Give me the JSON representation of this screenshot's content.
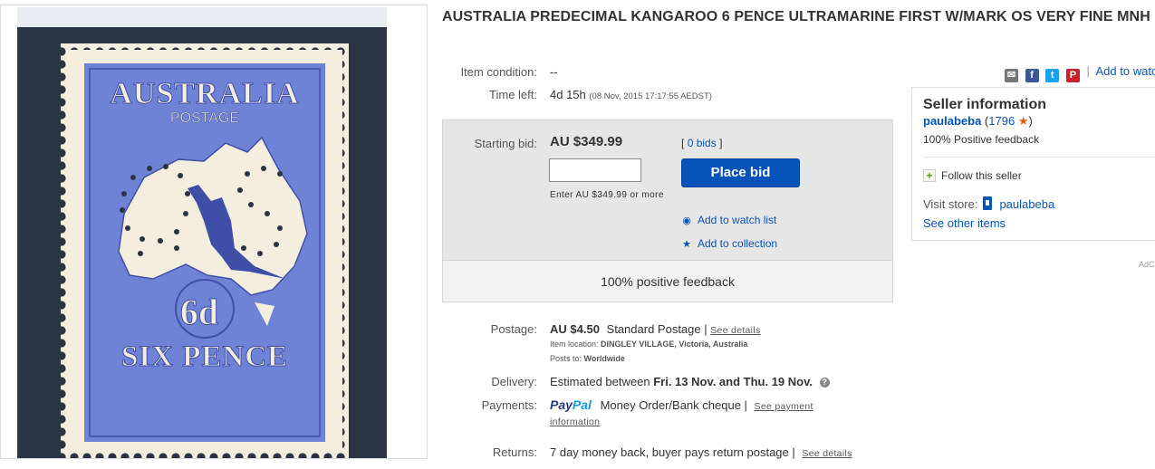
{
  "title": "AUSTRALIA PREDECIMAL KANGAROO 6 PENCE ULTRAMARINE FIRST W/MARK OS VERY FINE MNH",
  "stamp": {
    "top_text": "AUSTRALIA",
    "sub_text": "POSTAGE",
    "value_text": "6d",
    "bottom_text": "SIX PENCE"
  },
  "condition": {
    "label": "Item condition:",
    "value": "--"
  },
  "time_left": {
    "label": "Time left:",
    "value": "4d 15h",
    "detail": "(08 Nov, 2015   17:17:55 AEDST)"
  },
  "bid": {
    "label": "Starting bid:",
    "price": "AU $349.99",
    "bids_open": "[",
    "bids_link": "0 bids",
    "bids_close": "]",
    "input_value": "",
    "hint": "Enter AU $349.99 or more",
    "button": "Place bid",
    "watch": "Add to watch list",
    "collection": "Add to collection",
    "footer": "100% positive feedback"
  },
  "share": {
    "watch_link": "Add to watc",
    "divider": "|"
  },
  "seller": {
    "title": "Seller information",
    "name": "paulabeba",
    "score_open": "(",
    "score": "1796",
    "score_close": ")",
    "feedback": "100% Positive feedback",
    "follow": "Follow this seller",
    "visit_label": "Visit store:",
    "store": "paulabeba",
    "see_other": "See other items"
  },
  "ad_label": "AdC",
  "postage": {
    "label": "Postage:",
    "price": "AU $4.50",
    "method": "Standard Postage |",
    "details": "See details",
    "location_label": "Item location:",
    "location": "DINGLEY VILLAGE, Victoria, Australia",
    "posts_label": "Posts to:",
    "posts": "Worldwide"
  },
  "delivery": {
    "label": "Delivery:",
    "prefix": "Estimated between",
    "range": "Fri. 13 Nov. and Thu. 19 Nov."
  },
  "payments": {
    "label": "Payments:",
    "paypal_a": "Pay",
    "paypal_b": "Pal",
    "methods": "Money Order/Bank cheque  |",
    "details_a": "See payment",
    "details_b": "information"
  },
  "returns": {
    "label": "Returns:",
    "value": "7 day money back, buyer pays return postage |",
    "details": "See details"
  },
  "colors": {
    "link": "#0654ba",
    "stamp": "#6f83d6",
    "stamp_dark": "#3f4fa8",
    "paper": "#f4eedf",
    "frame": "#2b3442"
  }
}
